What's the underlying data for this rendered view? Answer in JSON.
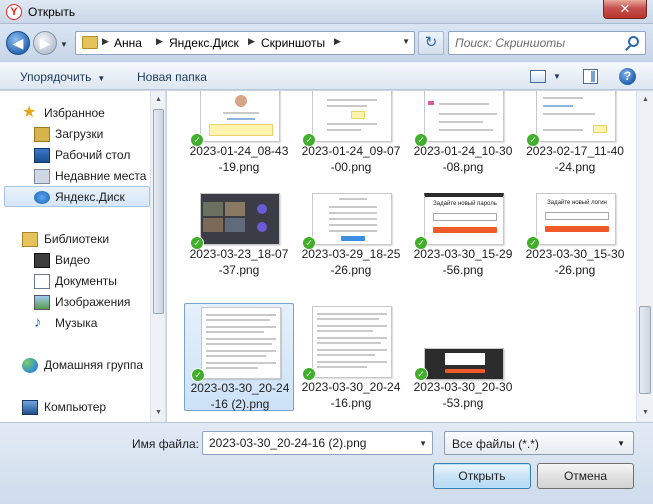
{
  "window": {
    "title": "Открыть",
    "close_label": "✕",
    "app_icon_letter": "Y"
  },
  "address": {
    "crumbs": [
      "Анна",
      "Яндекс.Диск",
      "Скриншоты"
    ],
    "search_placeholder": "Поиск: Скриншоты"
  },
  "toolbar": {
    "organize_label": "Упорядочить",
    "new_folder_label": "Новая папка",
    "help_label": "?"
  },
  "nav": {
    "items": [
      {
        "label": "Избранное",
        "icon": "star-icon"
      },
      {
        "label": "Загрузки",
        "icon": "downloads-icon"
      },
      {
        "label": "Рабочий стол",
        "icon": "desktop-icon"
      },
      {
        "label": "Недавние места",
        "icon": "recent-places-icon"
      },
      {
        "label": "Яндекс.Диск",
        "icon": "yandex-disk-icon",
        "selected": true
      },
      {
        "label": "Библиотеки",
        "icon": "libraries-icon"
      },
      {
        "label": "Видео",
        "icon": "video-icon"
      },
      {
        "label": "Документы",
        "icon": "documents-icon"
      },
      {
        "label": "Изображения",
        "icon": "images-icon"
      },
      {
        "label": "Музыка",
        "icon": "music-icon"
      },
      {
        "label": "Домашняя группа",
        "icon": "homegroup-icon"
      },
      {
        "label": "Компьютер",
        "icon": "computer-icon"
      }
    ]
  },
  "files": [
    {
      "line1": "2023-01-24_08-43",
      "line2": "-19.png"
    },
    {
      "line1": "2023-01-24_09-07",
      "line2": "-00.png"
    },
    {
      "line1": "2023-01-24_10-30",
      "line2": "-08.png"
    },
    {
      "line1": "2023-02-17_11-40",
      "line2": "-24.png"
    },
    {
      "line1": "2023-03-23_18-07",
      "line2": "-37.png"
    },
    {
      "line1": "2023-03-29_18-25",
      "line2": "-26.png"
    },
    {
      "line1": "2023-03-30_15-29",
      "line2": "-56.png"
    },
    {
      "line1": "2023-03-30_15-30",
      "line2": "-26.png"
    },
    {
      "line1": "2023-03-30_20-24",
      "line2": "-16 (2).png",
      "selected": true
    },
    {
      "line1": "2023-03-30_20-24",
      "line2": "-16.png"
    },
    {
      "line1": "2023-03-30_20-30",
      "line2": "-53.png"
    }
  ],
  "thumb_text": {
    "password": "Задайте новый пароль",
    "login": "Задайте новый логин"
  },
  "bottom": {
    "filename_label": "Имя файла:",
    "filename_value": "2023-03-30_20-24-16 (2).png",
    "filter_value": "Все файлы (*.*)",
    "open_label": "Открыть",
    "cancel_label": "Отмена"
  },
  "colors": {
    "accent": "#2a69b5",
    "check": "#3fae2a",
    "orange": "#f05a2a"
  }
}
